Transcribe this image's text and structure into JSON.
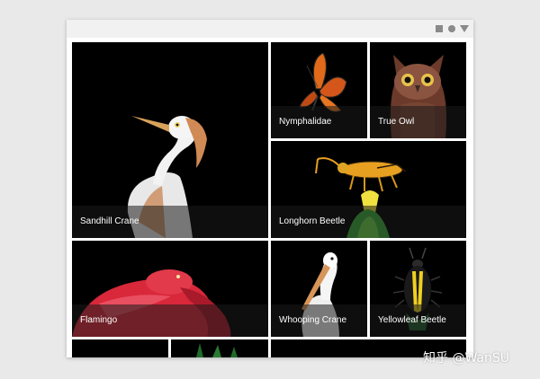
{
  "window": {
    "controls": [
      "square-icon",
      "circle-icon",
      "triangle-down-icon"
    ]
  },
  "gallery": {
    "tiles": [
      {
        "label": "Sandhill Crane",
        "subject": "egret-icon"
      },
      {
        "label": "Nymphalidae",
        "subject": "butterfly-icon"
      },
      {
        "label": "True Owl",
        "subject": "owl-icon"
      },
      {
        "label": "Longhorn Beetle",
        "subject": "beetle-icon"
      },
      {
        "label": "Flamingo",
        "subject": "flamingo-icon"
      },
      {
        "label": "Whooping Crane",
        "subject": "pelican-icon"
      },
      {
        "label": "Yellowleaf Beetle",
        "subject": "beetle-icon"
      }
    ]
  },
  "watermark": {
    "text": "知乎 @WanSU"
  },
  "colors": {
    "page_background": "#e9e9e9",
    "window_background": "#ffffff",
    "tile_background": "#000000",
    "caption_text": "#ffffff"
  }
}
